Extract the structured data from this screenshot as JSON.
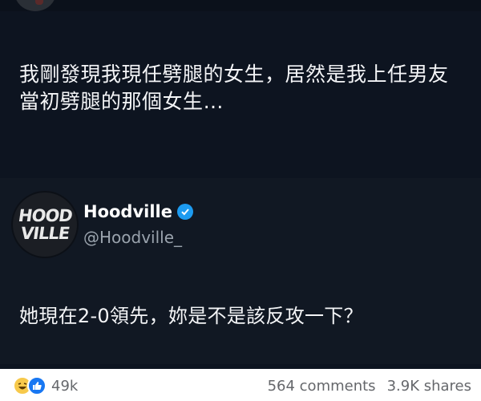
{
  "post": {
    "text": "我剛發現我現任劈腿的女生，居然是我上任男友當初劈腿的那個女生…"
  },
  "quoted": {
    "name": "Hoodville",
    "handle": "@Hoodville_",
    "logo_line1": "HOOD",
    "logo_line2": "VILLE",
    "text": "她現在2-0領先，妳是不是該反攻一下？"
  },
  "footer": {
    "reaction_count": "49k",
    "comments": "564 comments",
    "shares": "3.9K shares"
  },
  "colors": {
    "background": "#0d1420",
    "verified": "#1d9bf0",
    "like": "#1877f2"
  }
}
